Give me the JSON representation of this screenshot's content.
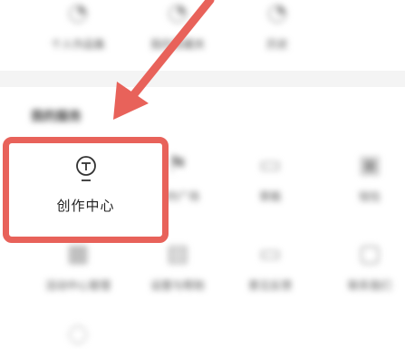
{
  "top_row": [
    {
      "label": "个人作品集",
      "icon": "circle-icon"
    },
    {
      "label": "我的收藏夹",
      "icon": "circle-icon"
    },
    {
      "label": "历史",
      "icon": "circle-icon"
    }
  ],
  "section": {
    "title": "我的服务"
  },
  "services_row1": [
    {
      "label": "创作中心",
      "icon": "lightbulb-icon"
    },
    {
      "label": "创作广场",
      "icon": "flag-icon"
    },
    {
      "label": "草稿",
      "icon": "folder-icon"
    },
    {
      "label": "钱包",
      "icon": "wallet-icon"
    }
  ],
  "services_row2": [
    {
      "label": "活动中心管理",
      "icon": "grid-icon"
    },
    {
      "label": "设置与帮助",
      "icon": "doc-icon"
    },
    {
      "label": "意见反馈",
      "icon": "folder-icon"
    },
    {
      "label": "联系我们",
      "icon": "box-icon"
    }
  ],
  "services_row3": [
    {
      "label": "",
      "icon": "lightbulb-icon"
    }
  ],
  "highlight": {
    "label": "创作中心",
    "border_color": "#e8625a"
  },
  "arrow": {
    "color": "#e8625a"
  }
}
